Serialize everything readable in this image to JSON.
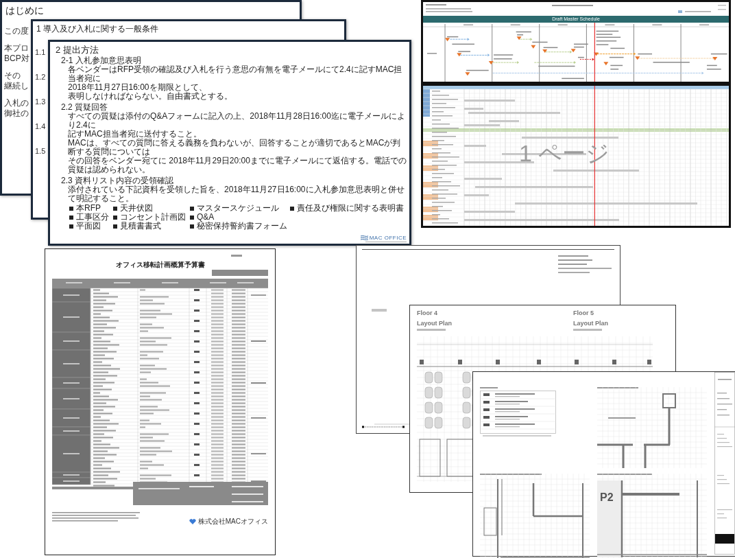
{
  "intro_page": {
    "title": "はじめに",
    "paragraphs": [
      {
        "lines": [
          "この度"
        ]
      },
      {
        "lines": [
          "本プロ",
          "BCP対"
        ]
      },
      {
        "lines": [
          "その",
          "継続し"
        ]
      },
      {
        "lines": [
          "入札の",
          "御社の"
        ]
      }
    ]
  },
  "conditions_page": {
    "title": "1 導入及び入札に関する一般条件",
    "section_numbers": [
      "1.1",
      "1.2",
      "1.3",
      "1.4",
      "1.5"
    ]
  },
  "submission_page": {
    "title": "2 提出方法",
    "sections": [
      {
        "heading": "2-1 入札参加意思表明",
        "lines": [
          "各ベンダーはRFP受領の確認及び入札を行う意思の有無を電子メールにて2.4に記すMAC担当者宛に",
          "2018年11月27日16:00を期限として、",
          "表明しなければならない。自由書式とする。"
        ]
      },
      {
        "heading": "2.2 質疑回答",
        "lines": [
          "すべての質疑は添付のQ&Aフォームに記入の上、2018年11月28日16:00迄に電子メールにより2.4に",
          "記すMAC担当者宛に送付すること。",
          "MACは、すべての質問に答える義務を負わないが、回答することが適切であるとMACが判断する質問については",
          "その回答をベンダー宛てに 2018年11月29日20:00までに電子メールにて返信する。電話での質疑は認められない。"
        ]
      },
      {
        "heading": "2.3 資料リスト内容の受領確認",
        "lines": [
          "添付されている下記資料を受領した旨を、2018年11月27日16:00に入札参加意思表明と併せて明記すること。"
        ],
        "items": [
          "本RFP",
          "工事区分",
          "平面図",
          "天井伏図",
          "コンセント計画図",
          "見積書書式",
          "マスタースケジュール",
          "Q&A",
          "秘密保持誓約書フォーム",
          "責任及び権限に関する表明書"
        ]
      }
    ],
    "logo": "MAC OFFICE"
  },
  "schedule_sheet": {
    "title": "Draft Master Schedule",
    "page_label": "1 ページ"
  },
  "budget_sheet": {
    "title": "オフィス移転計画概算予算書",
    "company": "株式会社MACオフィス"
  },
  "drawing_sheets": {
    "layout_sheet": {
      "plans": [
        {
          "floor": "Floor 4",
          "title": "Layout Plan"
        },
        {
          "floor": "Floor 5",
          "title": "Layout Plan"
        }
      ]
    },
    "detail_sheet": {
      "mark": "P2"
    }
  }
}
